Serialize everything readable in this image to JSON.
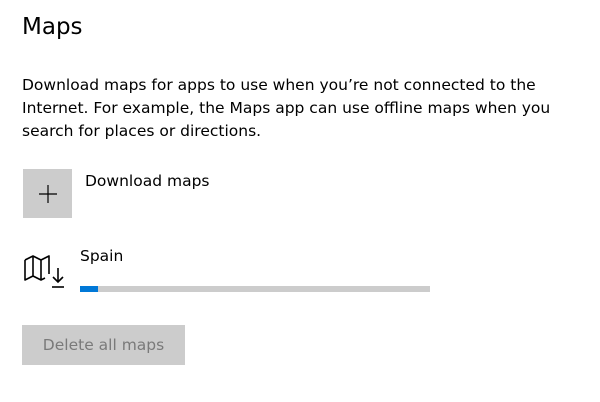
{
  "page": {
    "title": "Maps",
    "description": "Download maps for apps to use when you’re not connected to the Internet. For example, the Maps app can use offline maps when you search for places or directions."
  },
  "download_maps": {
    "label": "Download maps",
    "icon": "plus-icon"
  },
  "maps": [
    {
      "name": "Spain",
      "icon": "map-download-icon",
      "progress_fraction": 0.05
    }
  ],
  "delete_all": {
    "label": "Delete all maps",
    "disabled": true
  },
  "colors": {
    "accent": "#0078d7",
    "tile_bg": "#cccccc",
    "disabled_text": "#7a7a7a"
  }
}
